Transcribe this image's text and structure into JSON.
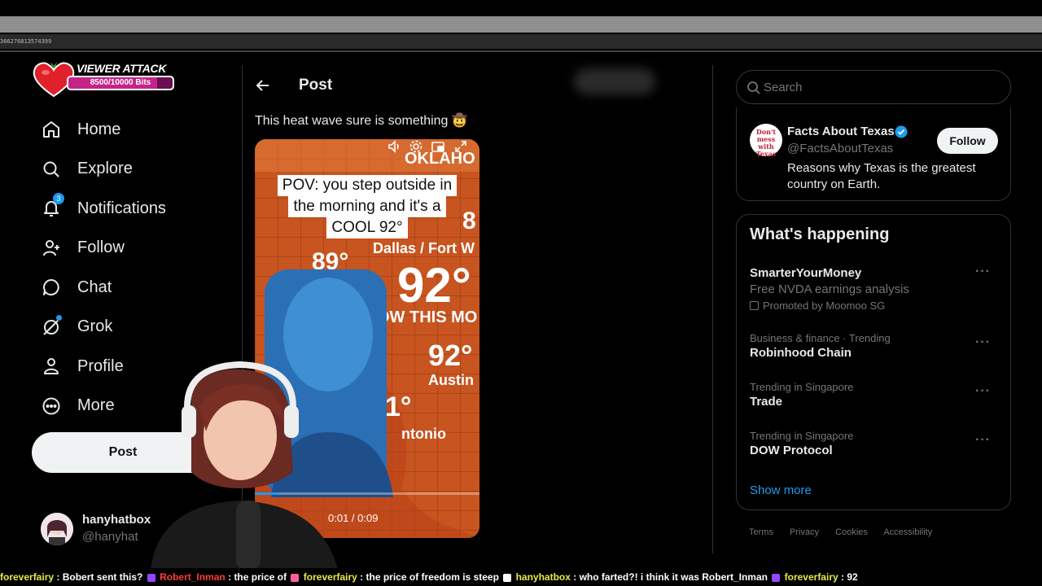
{
  "browser": {
    "url_fragment": "366276813574399"
  },
  "overlay": {
    "title": "VIEWER ATTACK",
    "progress_text": "8500/10000 Bits",
    "progress_fraction": 0.85
  },
  "nav": {
    "items": [
      {
        "label": "Home",
        "icon": "home-icon"
      },
      {
        "label": "Explore",
        "icon": "search-icon"
      },
      {
        "label": "Notifications",
        "icon": "bell-icon",
        "badge": "3"
      },
      {
        "label": "Follow",
        "icon": "add-person-icon"
      },
      {
        "label": "Chat",
        "icon": "chat-bubble-icon"
      },
      {
        "label": "Grok",
        "icon": "grok-icon"
      },
      {
        "label": "Profile",
        "icon": "person-icon"
      },
      {
        "label": "More",
        "icon": "more-circle-icon"
      }
    ],
    "post_button": "Post",
    "profile": {
      "name": "hanyhatbox",
      "handle": "@hanyhat"
    }
  },
  "center": {
    "header_title": "Post",
    "tweet_text": "This heat wave sure is something 🤠",
    "video": {
      "caption_lines": [
        "POV: you step outside in",
        "the morning and it's a",
        "COOL 92°"
      ],
      "time": "0:01 / 0:09",
      "map_labels": {
        "state": "OKLAHO",
        "city1": "Dallas / Fort W",
        "temp1": "92°",
        "temp2": "89°",
        "banner": "OW THIS MO",
        "temp3": "92°",
        "city2": "Austin",
        "temp4": "1°",
        "city3": "ntonio",
        "temp5": "8"
      }
    }
  },
  "right": {
    "search_placeholder": "Search",
    "suggested": {
      "name": "Facts About Texas",
      "handle": "@FactsAboutTexas",
      "bio": "Reasons why Texas is the greatest country on Earth.",
      "follow_label": "Follow",
      "logo_text": "Don't mess with Texas"
    },
    "whats_happening": {
      "title": "What's happening",
      "trends": [
        {
          "context": "",
          "name": "SmarterYourMoney",
          "sub": "Free NVDA earnings analysis",
          "promo": "Promoted by Moomoo SG"
        },
        {
          "context": "Business & finance · Trending",
          "name": "Robinhood Chain"
        },
        {
          "context": "Trending in Singapore",
          "name": "Trade"
        },
        {
          "context": "Trending in Singapore",
          "name": "DOW Protocol"
        }
      ],
      "show_more": "Show more"
    },
    "footer": [
      "Terms",
      "Privacy",
      "Cookies",
      "Accessibility"
    ]
  },
  "chat": [
    {
      "user": "foreverfairy",
      "msg": "Bobert sent this?",
      "color": "#e8e84a"
    },
    {
      "user": "Robert_Inman",
      "msg": "the price of",
      "color": "#ff3b3b"
    },
    {
      "user": "foreverfairy",
      "msg": "the price of freedom is steep",
      "color": "#e8e84a"
    },
    {
      "user": "hanyhatbox",
      "msg": "who farted?! i think it was Robert_Inman",
      "color": "#e8e84a"
    },
    {
      "user": "foreverfairy",
      "msg": "92",
      "color": "#e8e84a"
    }
  ],
  "colors": {
    "accent": "#1d9bf0",
    "bg": "#000000",
    "text": "#e7e9ea",
    "muted": "#71767b"
  }
}
